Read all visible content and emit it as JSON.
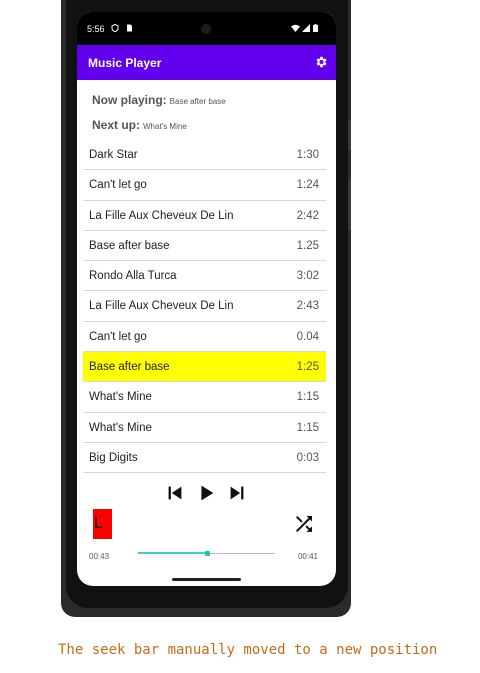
{
  "status_bar": {
    "time": "5:56",
    "icons": [
      "shield-icon",
      "sim-icon",
      "wifi-icon",
      "signal-icon",
      "battery-icon"
    ]
  },
  "app_bar": {
    "title": "Music Player",
    "settings_icon": "gear-icon"
  },
  "now_playing": {
    "label": "Now playing:",
    "value": "Base after base"
  },
  "next_up": {
    "label": "Next up:",
    "value": "What's Mine"
  },
  "tracks": [
    {
      "title": "Dark Star",
      "duration": "1:30"
    },
    {
      "title": "Can't let go",
      "duration": "1:24"
    },
    {
      "title": "La Fille Aux Cheveux De Lin",
      "duration": "2:42"
    },
    {
      "title": "Base after base",
      "duration": "1.25"
    },
    {
      "title": "Rondo Alla Turca",
      "duration": "3:02"
    },
    {
      "title": "La Fille Aux Cheveux De Lin",
      "duration": "2:43"
    },
    {
      "title": "Can't let go",
      "duration": "0.04"
    },
    {
      "title": "Base after base",
      "duration": "1:25",
      "selected": true
    },
    {
      "title": "What's Mine",
      "duration": "1:15"
    },
    {
      "title": "What's Mine",
      "duration": "1:15"
    },
    {
      "title": "Big Digits",
      "duration": "0:03"
    }
  ],
  "controls": {
    "previous_icon": "skip-previous-icon",
    "play_icon": "play-icon",
    "next_icon": "skip-next-icon",
    "shuffle_icon": "shuffle-icon",
    "badge": "L",
    "highlight_color": "#ffff00",
    "accent_color": "#6200ee",
    "seek_color": "#1ec2b7"
  },
  "seek_bar": {
    "elapsed": "00:43",
    "remaining": "00:41",
    "progress": 0.5
  },
  "caption": "The seek bar manually moved to a new position"
}
